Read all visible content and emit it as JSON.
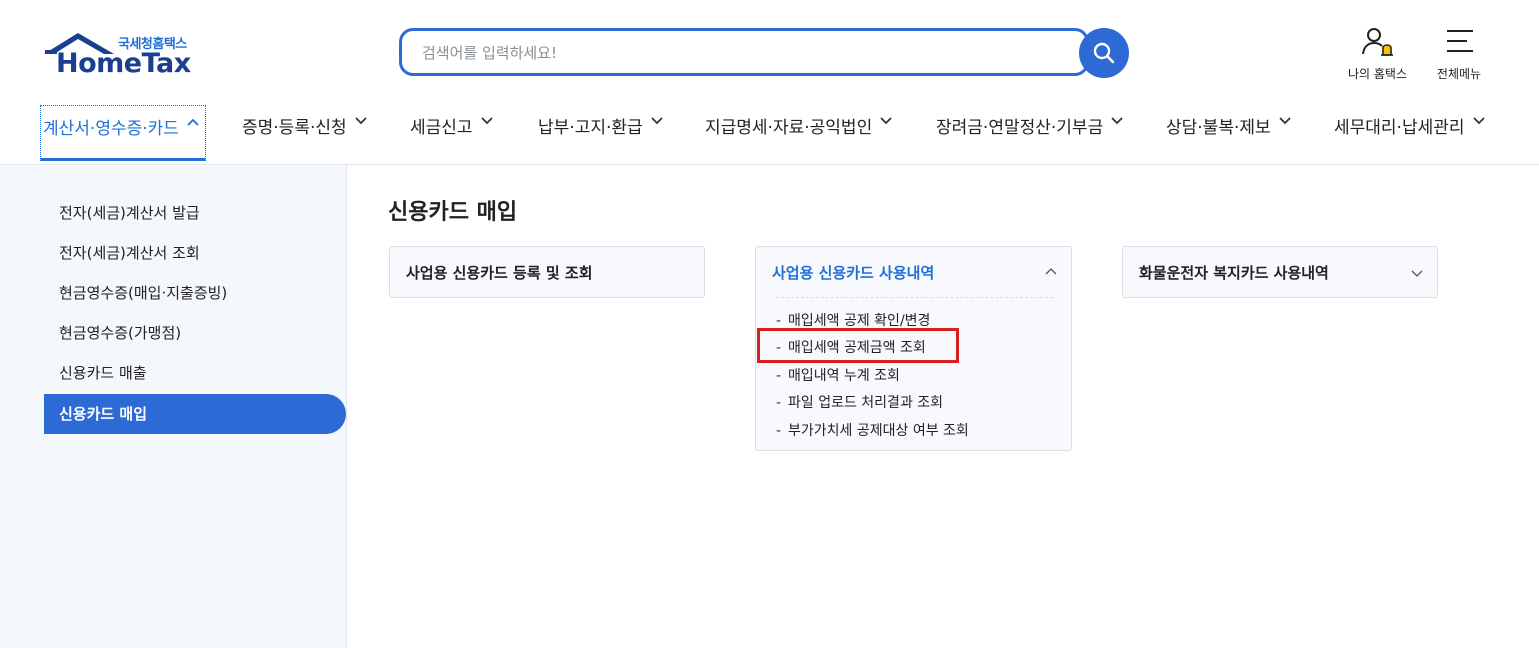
{
  "logo": {
    "subtitle": "국세청홈택스",
    "title": "HomeTax"
  },
  "search": {
    "placeholder": "검색어를 입력하세요!"
  },
  "top_icons": {
    "my_hometax": "나의 홈택스",
    "all_menu": "전체메뉴"
  },
  "nav": [
    {
      "label": "계산서·영수증·카드",
      "active": true
    },
    {
      "label": "증명·등록·신청"
    },
    {
      "label": "세금신고"
    },
    {
      "label": "납부·고지·환급"
    },
    {
      "label": "지급명세·자료·공익법인"
    },
    {
      "label": "장려금·연말정산·기부금"
    },
    {
      "label": "상담·불복·제보"
    },
    {
      "label": "세무대리·납세관리"
    }
  ],
  "sidebar": [
    {
      "label": "전자(세금)계산서 발급"
    },
    {
      "label": "전자(세금)계산서 조회"
    },
    {
      "label": "현금영수증(매입·지출증빙)"
    },
    {
      "label": "현금영수증(가맹점)"
    },
    {
      "label": "신용카드 매출"
    },
    {
      "label": "신용카드 매입",
      "active": true
    }
  ],
  "main": {
    "title": "신용카드 매입",
    "cards": [
      {
        "title": "사업용 신용카드 등록 및 조회"
      },
      {
        "title": "사업용 신용카드 사용내역",
        "expanded": true,
        "items": [
          {
            "label": "매입세액 공제 확인/변경"
          },
          {
            "label": "매입세액 공제금액 조회",
            "highlighted": true
          },
          {
            "label": "매입내역 누계 조회"
          },
          {
            "label": "파일 업로드 처리결과 조회"
          },
          {
            "label": "부가가치세 공제대상 여부 조회"
          }
        ]
      },
      {
        "title": "화물운전자 복지카드 사용내역"
      }
    ]
  },
  "colors": {
    "accent": "#2d6ad6",
    "brand_dark": "#1b3f8f",
    "highlight": "#d9201f",
    "bell": "#f5c400"
  }
}
